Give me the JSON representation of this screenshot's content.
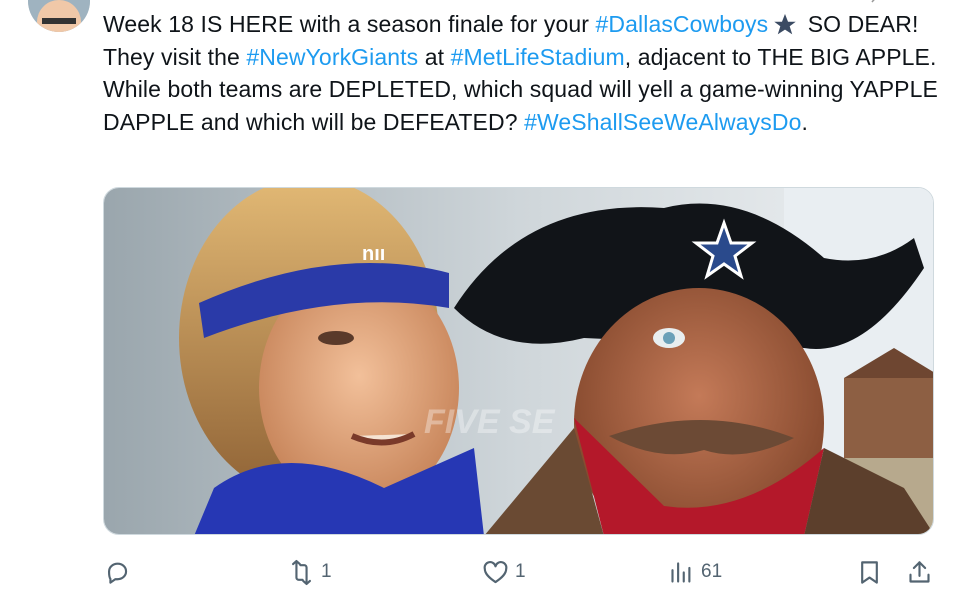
{
  "tweet": {
    "text_segments": [
      {
        "text": "Week 18 IS HERE with a season finale for your ",
        "link": false
      },
      {
        "text": "#DallasCowboys",
        "link": true
      },
      {
        "text": " SO DEAR! They visit the ",
        "link": false
      },
      {
        "text": "#NewYorkGiants",
        "link": true
      },
      {
        "text": " at ",
        "link": false
      },
      {
        "text": "#MetLifeStadium",
        "link": true
      },
      {
        "text": ", adjacent to THE BIG APPLE. While both teams are DEPLETED, which squad will yell a game-winning YAPPLE DAPPLE and which will be DEFEATED? ",
        "link": false
      },
      {
        "text": "#WeShallSeeWeAlwaysDo",
        "link": true
      },
      {
        "text": ".",
        "link": false
      }
    ],
    "emoji_after_segment": 1,
    "emoji_name": "blue-star-emoji",
    "image_caption": "Giants quarterback with headband facing cowboy in black hat with star",
    "image_watermark": "FIVE SE"
  },
  "actions": {
    "reply": {
      "icon": "reply-icon",
      "count": ""
    },
    "retweet": {
      "icon": "retweet-icon",
      "count": "1"
    },
    "like": {
      "icon": "heart-icon",
      "count": "1"
    },
    "views": {
      "icon": "views-icon",
      "count": "61"
    },
    "bookmark": {
      "icon": "bookmark-icon",
      "count": ""
    },
    "share": {
      "icon": "share-icon",
      "count": ""
    }
  },
  "colors": {
    "link": "#1d9bf0",
    "text": "#0f1419",
    "muted": "#536471"
  }
}
